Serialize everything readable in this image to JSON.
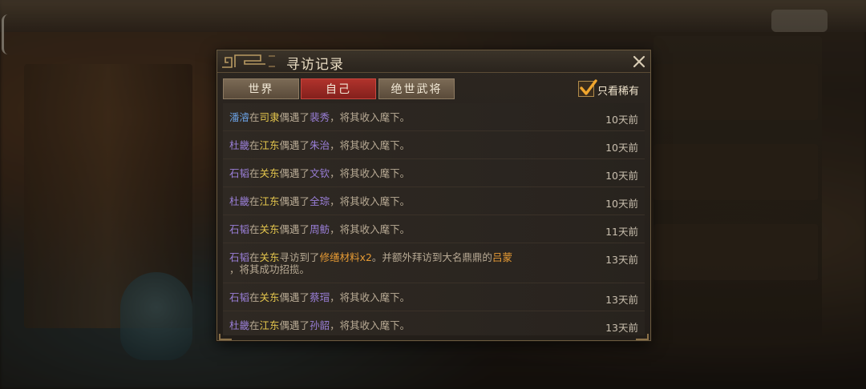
{
  "dialog": {
    "title": "寻访记录",
    "tabs": [
      {
        "label": "世界",
        "active": false
      },
      {
        "label": "自己",
        "active": true
      },
      {
        "label": "绝世武将",
        "active": false
      }
    ],
    "rare_only": {
      "label": "只看稀有",
      "checked": true
    }
  },
  "records": [
    {
      "who": "潘濬",
      "who_color": "blue",
      "at": "在",
      "place": "司隶",
      "verb": "偶遇了",
      "got": "裴秀",
      "tail": "，将其收入麾下。",
      "time": "10天前"
    },
    {
      "who": "杜畿",
      "at": "在",
      "place": "江东",
      "verb": "偶遇了",
      "got": "朱治",
      "tail": "，将其收入麾下。",
      "time": "10天前"
    },
    {
      "who": "石韬",
      "at": "在",
      "place": "关东",
      "verb": "偶遇了",
      "got": "文钦",
      "tail": "，将其收入麾下。",
      "time": "10天前"
    },
    {
      "who": "杜畿",
      "at": "在",
      "place": "江东",
      "verb": "偶遇了",
      "got": "全琮",
      "tail": "，将其收入麾下。",
      "time": "10天前"
    },
    {
      "who": "石韬",
      "at": "在",
      "place": "关东",
      "verb": "偶遇了",
      "got": "周鲂",
      "tail": "，将其收入麾下。",
      "time": "11天前"
    },
    {
      "who": "石韬",
      "at": "在",
      "place": "关东",
      "verb": "寻访到了",
      "item": "修缮材料x2",
      "mid": "。并额外拜访到大名鼎鼎的",
      "famous": "吕蒙",
      "line2": "，将其成功招揽。",
      "time": "13天前"
    },
    {
      "who": "石韬",
      "at": "在",
      "place": "关东",
      "verb": "偶遇了",
      "got": "蔡瑁",
      "tail": "，将其收入麾下。",
      "time": "13天前"
    },
    {
      "who": "杜畿",
      "at": "在",
      "place": "江东",
      "verb": "偶遇了",
      "got": "孙韶",
      "tail": "，将其收入麾下。",
      "time": "13天前"
    }
  ],
  "icons": {
    "close": "close-icon",
    "check": "check-icon",
    "ornament": "title-ornament-icon"
  },
  "colors": {
    "tab_active": "#b0332c",
    "name_purple": "#9a7fd8",
    "name_blue": "#6a9fe0",
    "place_yellow": "#e4c64d",
    "item_orange": "#e59a34"
  }
}
